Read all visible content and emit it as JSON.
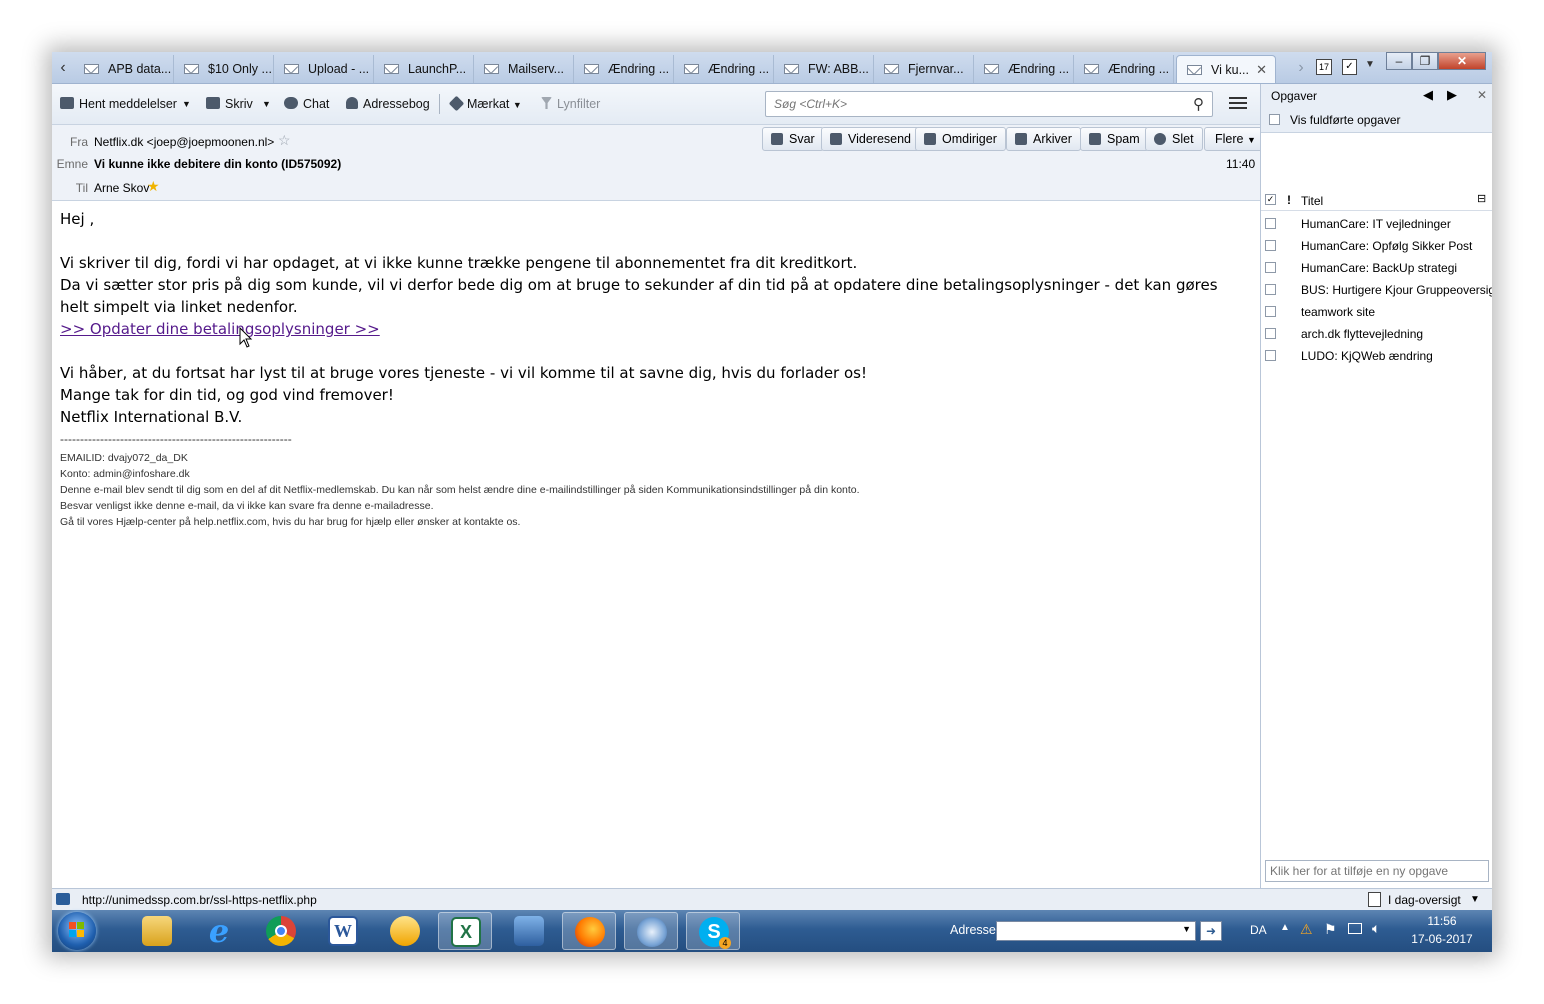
{
  "tabs": [
    {
      "label": "APB data..."
    },
    {
      "label": "$10 Only ..."
    },
    {
      "label": "Upload - ..."
    },
    {
      "label": "LaunchP..."
    },
    {
      "label": "Mailserv..."
    },
    {
      "label": "Ændring ..."
    },
    {
      "label": "Ændring ..."
    },
    {
      "label": "FW: ABB..."
    },
    {
      "label": "Fjernvar..."
    },
    {
      "label": "Ændring ..."
    },
    {
      "label": "Ændring ..."
    },
    {
      "label": "Vi ku..."
    }
  ],
  "toolbar": {
    "get_mail": "Hent meddelelser",
    "write": "Skriv",
    "chat": "Chat",
    "address_book": "Adressebog",
    "tag": "Mærkat",
    "quick_filter": "Lynfilter",
    "search_placeholder": "Søg <Ctrl+K>"
  },
  "header": {
    "from_label": "Fra",
    "from_value": "Netflix.dk <joep@joepmoonen.nl>",
    "subject_label": "Emne",
    "subject_value": "Vi kunne ikke debitere din konto (ID575092)",
    "to_label": "Til",
    "to_value": "Arne Skov",
    "time": "11:40",
    "actions": {
      "reply": "Svar",
      "forward": "Videresend",
      "redirect": "Omdiriger",
      "archive": "Arkiver",
      "spam": "Spam",
      "delete": "Slet",
      "more": "Flere"
    }
  },
  "body": {
    "greeting": "Hej ,",
    "line1": "Vi skriver til dig, fordi vi har opdaget, at vi ikke kunne trække pengene til abonnementet fra dit kreditkort.",
    "line2": "Da vi sætter stor pris på dig som kunde, vil vi derfor bede dig om at bruge to sekunder af din tid på at opdatere dine betalingsoplysninger - det kan gøres helt simpelt via linket nedenfor.",
    "link": ">> Opdater dine betalingsoplysninger >>",
    "line3": "Vi håber, at du fortsat har lyst til at bruge vores tjeneste - vi vil komme til at savne dig, hvis du forlader os!",
    "line4": "Mange tak for din tid, og god vind fremover!",
    "line5": "Netflix International B.V.",
    "separator": "----------------------------------------------------------",
    "footer": [
      "EMAILID: dvajy072_da_DK",
      "Konto: admin@infoshare.dk",
      "Denne e-mail blev sendt til dig som en del af dit Netflix-medlemskab. Du kan når som helst ændre dine e-mailindstillinger på siden Kommunikationsindstillinger på din konto.",
      "Besvar venligst ikke denne e-mail, da vi ikke kan svare fra denne e-mailadresse.",
      "Gå til vores Hjælp-center på help.netflix.com, hvis du har brug for hjælp eller ønsker at kontakte os."
    ]
  },
  "tasks_pane": {
    "title": "Opgaver",
    "show_completed": "Vis fuldførte opgaver",
    "col_title": "Titel",
    "col_priority": "!",
    "items": [
      "HumanCare: IT vejledninger",
      "HumanCare: Opfølg Sikker Post",
      "HumanCare: BackUp strategi",
      "BUS: Hurtigere Kjour Gruppeoversigt",
      "teamwork site",
      "arch.dk flyttevejledning",
      "LUDO: KjQWeb ændring"
    ],
    "new_task_placeholder": "Klik her for at tilføje en ny opgave"
  },
  "status": {
    "url": "http://unimedssp.com.br/ssl-https-netflix.php",
    "today_pane": "I dag-oversigt"
  },
  "taskbar": {
    "address_label": "Adresse",
    "language": "DA",
    "time": "11:56",
    "date": "17-06-2017",
    "skype_badge": "4",
    "calendar_day": "17"
  }
}
